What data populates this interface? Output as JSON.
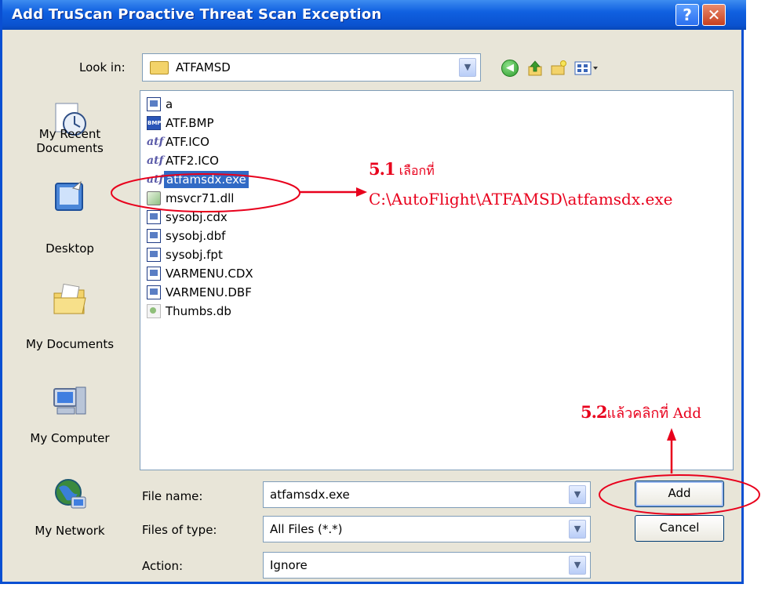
{
  "window": {
    "title": "Add TruScan Proactive Threat Scan Exception",
    "help_glyph": "?",
    "close_glyph": "✕"
  },
  "toolbar": {
    "look_in_label": "Look in:",
    "look_in_value": "ATFAMSD",
    "icons": [
      "back-icon",
      "up-folder-icon",
      "new-folder-icon",
      "views-menu-icon"
    ]
  },
  "places": [
    {
      "label_line1": "My Recent",
      "label_line2": "Documents",
      "icon": "recent-documents-icon"
    },
    {
      "label_line1": "Desktop",
      "label_line2": "",
      "icon": "desktop-icon"
    },
    {
      "label_line1": "My Documents",
      "label_line2": "",
      "icon": "my-documents-icon"
    },
    {
      "label_line1": "My Computer",
      "label_line2": "",
      "icon": "my-computer-icon"
    },
    {
      "label_line1": "My Network",
      "label_line2": "",
      "icon": "my-network-icon"
    }
  ],
  "files": [
    {
      "name": "a",
      "icon": "doc"
    },
    {
      "name": "ATF.BMP",
      "icon": "bmp"
    },
    {
      "name": "ATF.ICO",
      "icon": "atf"
    },
    {
      "name": "ATF2.ICO",
      "icon": "atf"
    },
    {
      "name": "atfamsdx.exe",
      "icon": "atf",
      "selected": true
    },
    {
      "name": "msvcr71.dll",
      "icon": "dll"
    },
    {
      "name": "sysobj.cdx",
      "icon": "doc"
    },
    {
      "name": "sysobj.dbf",
      "icon": "doc"
    },
    {
      "name": "sysobj.fpt",
      "icon": "doc"
    },
    {
      "name": "VARMENU.CDX",
      "icon": "doc"
    },
    {
      "name": "VARMENU.DBF",
      "icon": "doc"
    },
    {
      "name": "Thumbs.db",
      "icon": "db"
    }
  ],
  "fields": {
    "file_name_label": "File name:",
    "file_name_value": "atfamsdx.exe",
    "files_of_type_label": "Files of type:",
    "files_of_type_value": "All Files (*.*)",
    "action_label": "Action:",
    "action_value": "Ignore"
  },
  "buttons": {
    "add": "Add",
    "cancel": "Cancel"
  },
  "annotations": {
    "step1_num": "5.1",
    "step1_text": " เลือกที่",
    "step1_path": "C:\\AutoFlight\\ATFAMSD\\atfamsdx.exe",
    "step2_num": "5.2",
    "step2_text": "แล้วคลิกที่ Add",
    "color": "#e8001c"
  }
}
